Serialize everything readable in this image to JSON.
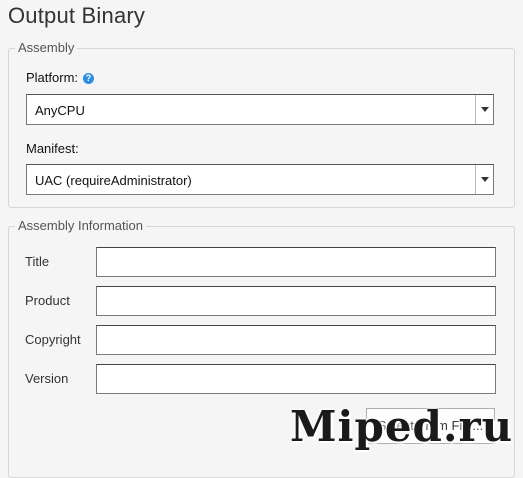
{
  "title": "Output Binary",
  "assembly": {
    "legend": "Assembly",
    "platform": {
      "label": "Platform:",
      "value": "AnyCPU",
      "help_icon": "help-circle-icon"
    },
    "manifest": {
      "label": "Manifest:",
      "value": "UAC (requireAdministrator)"
    }
  },
  "info": {
    "legend": "Assembly Information",
    "fields": [
      {
        "label": "Title",
        "value": ""
      },
      {
        "label": "Product",
        "value": ""
      },
      {
        "label": "Copyright",
        "value": ""
      },
      {
        "label": "Version",
        "value": ""
      }
    ],
    "select_file_label": "Select From File..."
  },
  "watermark": "Miped.ru",
  "colors": {
    "help_icon": "#2b8ee0",
    "background": "#f5f5f5"
  }
}
